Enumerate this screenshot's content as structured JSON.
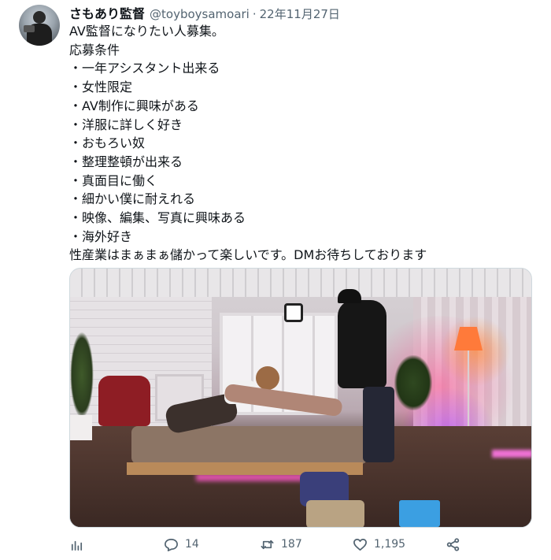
{
  "tweet": {
    "display_name": "さもあり監督",
    "handle": "@toyboysamoari",
    "separator": "·",
    "date": "22年11月27日",
    "lines": [
      "AV監督になりたい人募集。",
      "応募条件",
      "・一年アシスタント出来る",
      "・女性限定",
      "・AV制作に興味がある",
      "・洋服に詳しく好き",
      "・おもろい奴",
      "・整理整頓が出来る",
      "・真面目に働く",
      "・細かい僕に耐えれる",
      "・映像、編集、写真に興味ある",
      "・海外好き",
      "性産業はまぁまぁ儲かって楽しいです。DMお待ちしております"
    ]
  },
  "actions": {
    "views_icon": "bar-chart-icon",
    "reply_icon": "reply-icon",
    "reply_count": "14",
    "retweet_icon": "retweet-icon",
    "retweet_count": "187",
    "like_icon": "heart-icon",
    "like_count": "1,195",
    "share_icon": "share-icon"
  },
  "colors": {
    "text_primary": "#0f1419",
    "text_secondary": "#536471",
    "border": "#cfd9de"
  }
}
